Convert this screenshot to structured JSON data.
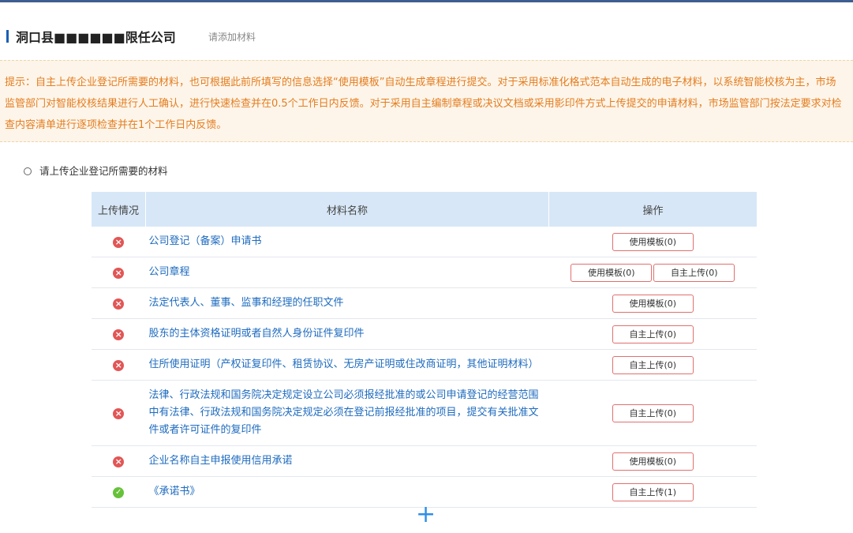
{
  "header": {
    "company_name": "洞口县■■■■■■限任公司",
    "hint": "请添加材料"
  },
  "notice": {
    "text": "提示：自主上传企业登记所需要的材料，也可根据此前所填写的信息选择“使用模板”自动生成章程进行提交。对于采用标准化格式范本自动生成的电子材料，以系统智能校核为主，市场监管部门对智能校核结果进行人工确认，进行快速检查并在0.5个工作日内反馈。对于采用自主编制章程或决议文档或采用影印件方式上传提交的申请材料，市场监管部门按法定要求对检查内容清单进行逐项检查并在1个工作日内反馈。"
  },
  "section": {
    "title": "请上传企业登记所需要的材料"
  },
  "table": {
    "headers": {
      "status": "上传情况",
      "name": "材料名称",
      "ops": "操作"
    },
    "rows": [
      {
        "status": "missing",
        "name": "公司登记（备案）申请书",
        "buttons": [
          "使用模板(0)"
        ]
      },
      {
        "status": "missing",
        "name": "公司章程",
        "buttons": [
          "使用模板(0)",
          "自主上传(0)"
        ]
      },
      {
        "status": "missing",
        "name": "法定代表人、董事、监事和经理的任职文件",
        "buttons": [
          "使用模板(0)"
        ]
      },
      {
        "status": "missing",
        "name": "股东的主体资格证明或者自然人身份证件复印件",
        "buttons": [
          "自主上传(0)"
        ]
      },
      {
        "status": "missing",
        "name": "住所使用证明（产权证复印件、租赁协议、无房产证明或住改商证明，其他证明材料）",
        "buttons": [
          "自主上传(0)"
        ]
      },
      {
        "status": "missing",
        "name": "法律、行政法规和国务院决定规定设立公司必须报经批准的或公司申请登记的经营范围中有法律、行政法规和国务院决定规定必须在登记前报经批准的项目，提交有关批准文件或者许可证件的复印件",
        "buttons": [
          "自主上传(0)"
        ]
      },
      {
        "status": "missing",
        "name": "企业名称自主申报使用信用承诺",
        "buttons": [
          "使用模板(0)"
        ]
      },
      {
        "status": "done",
        "name": "《承诺书》",
        "buttons": [
          "自主上传(1)"
        ]
      }
    ]
  },
  "icons": {
    "missing": "error-circle-icon",
    "done": "check-circle-icon",
    "add": "plus-icon"
  },
  "add_label": "+"
}
